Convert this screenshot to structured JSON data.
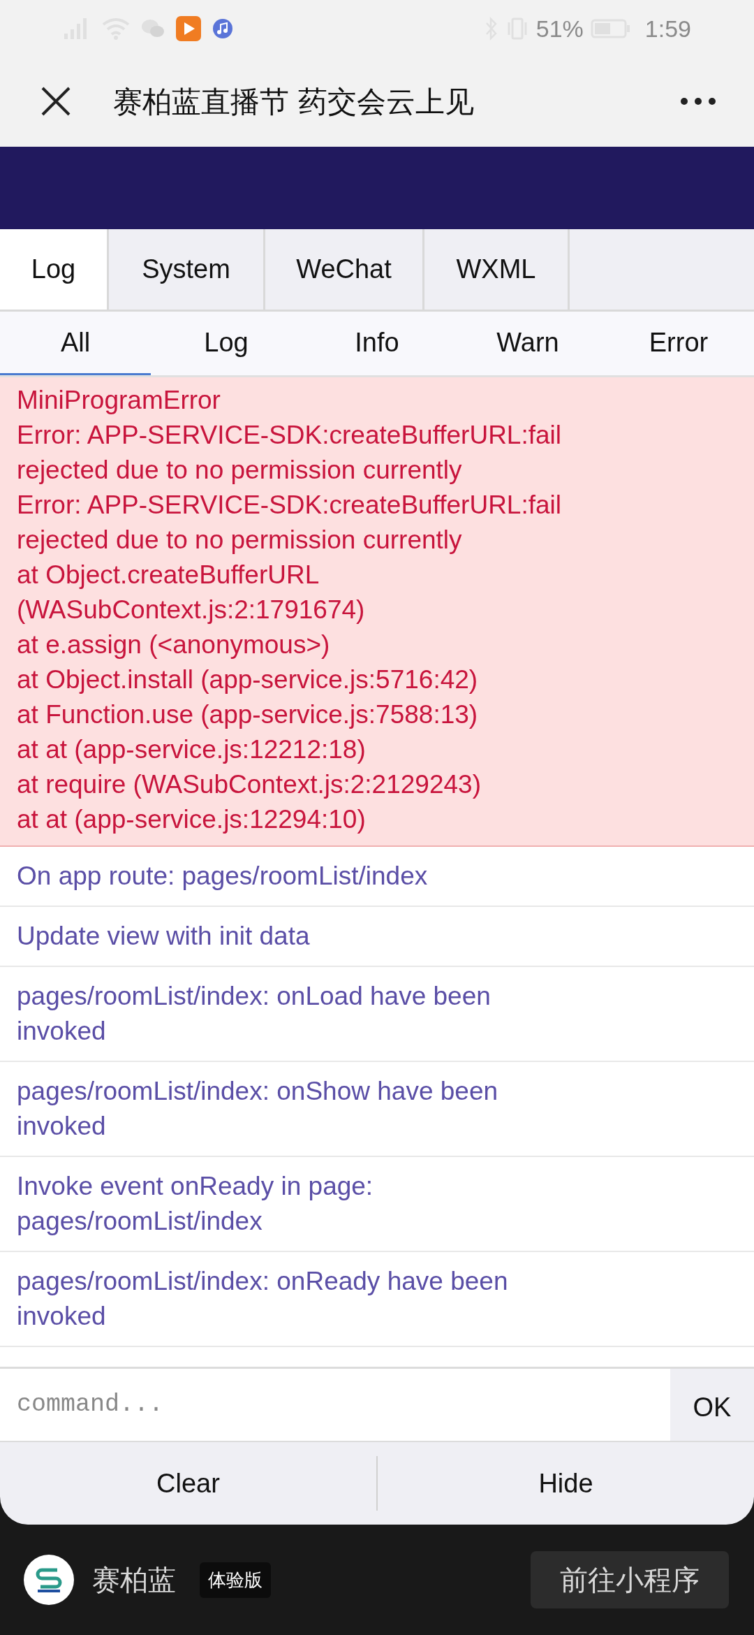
{
  "status_bar": {
    "battery": "51%",
    "time": "1:59"
  },
  "header": {
    "title": "赛柏蓝直播节 药交会云上见"
  },
  "log_tabs": [
    {
      "label": "Log",
      "selected": true
    },
    {
      "label": "System",
      "selected": false
    },
    {
      "label": "WeChat",
      "selected": false
    },
    {
      "label": "WXML",
      "selected": false
    }
  ],
  "filter_tabs": [
    {
      "label": "All",
      "selected": true
    },
    {
      "label": "Log",
      "selected": false
    },
    {
      "label": "Info",
      "selected": false
    },
    {
      "label": "Warn",
      "selected": false
    },
    {
      "label": "Error",
      "selected": false
    }
  ],
  "entries": [
    {
      "kind": "error",
      "lines": [
        "MiniProgramError",
        "Error: APP-SERVICE-SDK:createBufferURL:fail",
        "rejected due to no permission currently",
        "Error: APP-SERVICE-SDK:createBufferURL:fail",
        "rejected due to no permission currently",
        "at Object.createBufferURL",
        "(WASubContext.js:2:1791674)",
        "at e.assign (<anonymous>)",
        "at Object.install (app-service.js:5716:42)",
        "at Function.use (app-service.js:7588:13)",
        "at at (app-service.js:12212:18)",
        "at require (WASubContext.js:2:2129243)",
        "at at (app-service.js:12294:10)"
      ]
    },
    {
      "kind": "info",
      "text": "On app route: pages/roomList/index"
    },
    {
      "kind": "info",
      "text": "Update view with init data"
    },
    {
      "kind": "info",
      "text": "pages/roomList/index: onLoad have been invoked"
    },
    {
      "kind": "info",
      "text": "pages/roomList/index: onShow have been invoked"
    },
    {
      "kind": "info",
      "text": "Invoke event onReady in page: pages/roomList/index"
    },
    {
      "kind": "info",
      "text": "pages/roomList/index: onReady have been invoked"
    }
  ],
  "command": {
    "placeholder": "command...",
    "button": "OK"
  },
  "actions": [
    "Clear",
    "Hide"
  ],
  "footer": {
    "app_name": "赛柏蓝",
    "badge": "体验版",
    "button": "前往小程序"
  }
}
